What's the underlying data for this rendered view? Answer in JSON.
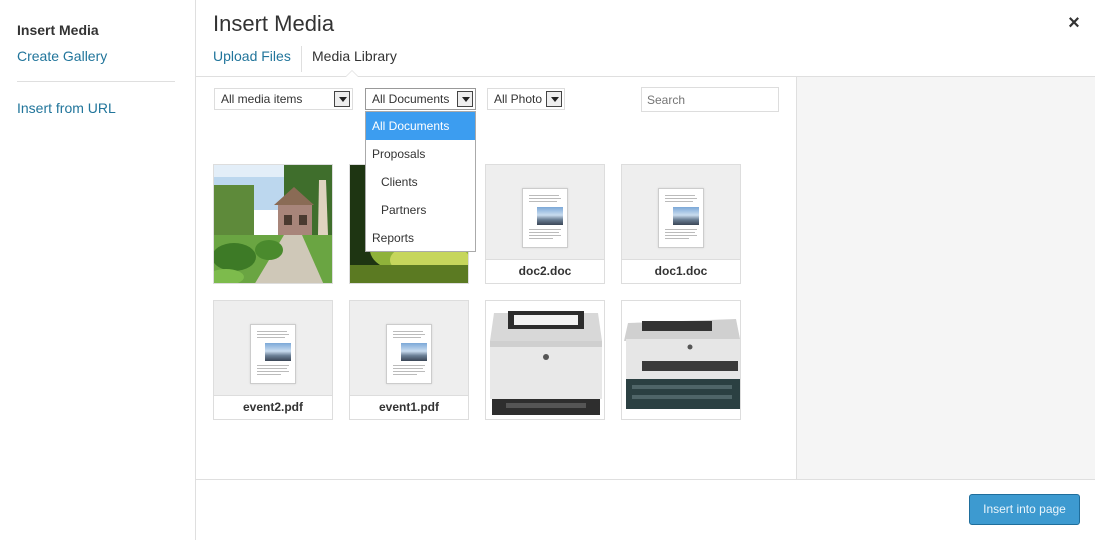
{
  "menu": {
    "insert_media": "Insert Media",
    "create_gallery": "Create Gallery",
    "insert_from_url": "Insert from URL"
  },
  "header": {
    "title": "Insert Media",
    "close_icon": "×",
    "tabs": [
      "Upload Files",
      "Media Library"
    ]
  },
  "filters": {
    "media_type": "All media items",
    "category": "All Documents",
    "photo": "All Photo",
    "search_placeholder": "Search"
  },
  "dropdown": {
    "options": [
      "All Documents",
      "Proposals",
      "Clients",
      "Partners",
      "Reports"
    ]
  },
  "attachments": {
    "doc2": "doc2.doc",
    "doc1": "doc1.doc",
    "event2": "event2.pdf",
    "event1": "event1.pdf"
  },
  "footer": {
    "insert_button": "Insert into page"
  },
  "colors": {
    "link": "#21759b",
    "primary_button": "#3d9ad0",
    "dropdown_selected": "#3c9df0"
  }
}
